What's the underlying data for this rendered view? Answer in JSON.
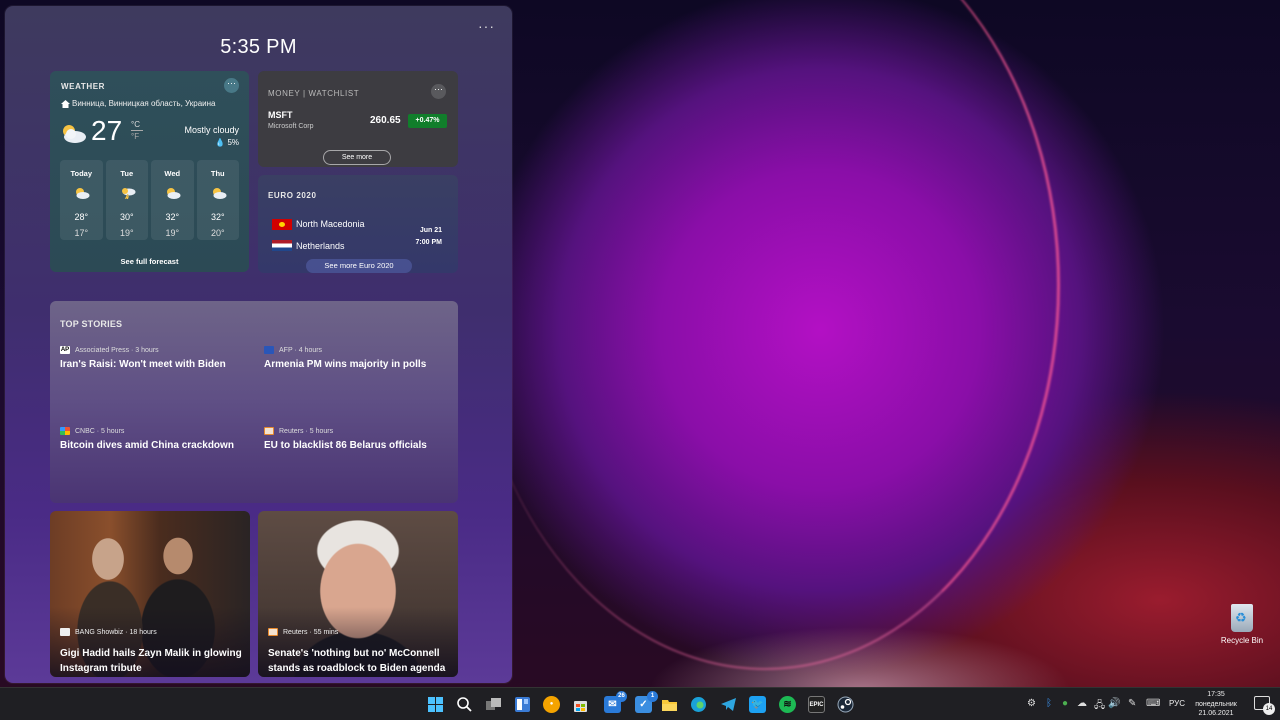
{
  "widgets": {
    "time": "5:35 PM",
    "more": "···",
    "weather": {
      "title": "WEATHER",
      "location": "Винница, Винницкая область, Украина",
      "temp": "27",
      "unit_c": "°C",
      "unit_f": "°F",
      "condition": "Mostly cloudy",
      "precip": "5%",
      "days": [
        {
          "name": "Today",
          "hi": "28°",
          "lo": "17°",
          "icon": "cloudy-sun-icon"
        },
        {
          "name": "Tue",
          "hi": "30°",
          "lo": "19°",
          "icon": "thunderstorm-icon"
        },
        {
          "name": "Wed",
          "hi": "32°",
          "lo": "19°",
          "icon": "cloudy-sun-icon"
        },
        {
          "name": "Thu",
          "hi": "32°",
          "lo": "20°",
          "icon": "cloudy-sun-icon"
        }
      ],
      "link": "See full forecast"
    },
    "money": {
      "title": "MONEY | WATCHLIST",
      "symbol": "MSFT",
      "company": "Microsoft Corp",
      "price": "260.65",
      "change": "+0.47%",
      "button": "See more"
    },
    "euro": {
      "title": "EURO 2020",
      "team1": "North Macedonia",
      "team2": "Netherlands",
      "date": "Jun 21",
      "time": "7:00 PM",
      "button": "See more Euro 2020"
    },
    "top_stories": {
      "title": "TOP STORIES",
      "items": [
        {
          "source": "Associated Press · 3 hours",
          "headline": "Iran's Raisi: Won't meet with Biden"
        },
        {
          "source": "AFP · 4 hours",
          "headline": "Armenia PM wins majority in polls"
        },
        {
          "source": "CNBC · 5 hours",
          "headline": "Bitcoin dives amid China crackdown"
        },
        {
          "source": "Reuters · 5 hours",
          "headline": "EU to blacklist 86 Belarus officials"
        }
      ]
    },
    "image_stories": [
      {
        "source": "BANG Showbiz · 18 hours",
        "headline": "Gigi Hadid hails Zayn Malik in glowing Instagram tribute"
      },
      {
        "source": "Reuters · 55 mins",
        "headline": "Senate's 'nothing but no' McConnell stands as roadblock to Biden agenda"
      }
    ]
  },
  "desktop": {
    "recycle_bin": "Recycle Bin"
  },
  "taskbar": {
    "mail_badge": "26",
    "todo_badge": "1",
    "lang": "РУС",
    "time": "17:35",
    "day": "понедельник",
    "date": "21.06.2021",
    "notif_count": "14"
  }
}
